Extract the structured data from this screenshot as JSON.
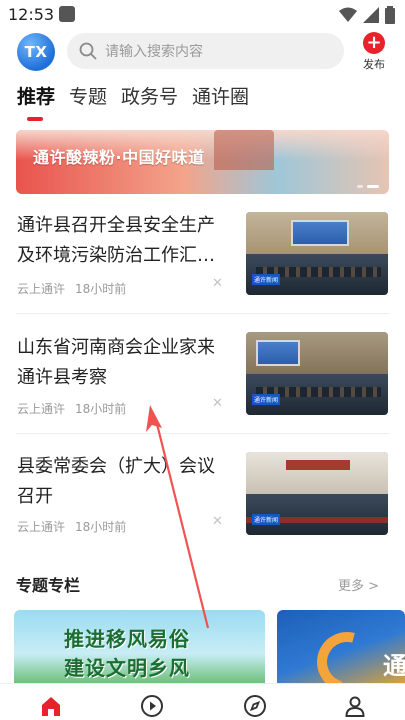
{
  "status_bar": {
    "time": "12:53"
  },
  "header": {
    "logo_text": "TX",
    "search_placeholder": "请输入搜索内容",
    "publish_label": "发布"
  },
  "tabs": [
    {
      "label": "推荐",
      "active": true
    },
    {
      "label": "专题",
      "active": false
    },
    {
      "label": "政务号",
      "active": false
    },
    {
      "label": "通许圈",
      "active": false
    }
  ],
  "banner": {
    "text": "通许酸辣粉·中国好味道"
  },
  "news": [
    {
      "title": "通许县召开全县安全生产及环境污染防治工作汇…",
      "source": "云上通许",
      "time": "18小时前",
      "thumb_label": "通许新闻"
    },
    {
      "title": "山东省河南商会企业家来通许县考察",
      "source": "云上通许",
      "time": "18小时前",
      "thumb_label": "通许新闻"
    },
    {
      "title": "县委常委会（扩大）会议召开",
      "source": "云上通许",
      "time": "18小时前",
      "thumb_label": "通许新闻"
    }
  ],
  "topics_section": {
    "title": "专题专栏",
    "more": "更多 >",
    "cards": [
      {
        "line1": "推进移风易俗",
        "line2": "建设文明乡风"
      },
      {
        "text": "通"
      }
    ]
  },
  "bottom_nav": [
    "home-icon",
    "video-play-icon",
    "compass-icon",
    "user-icon"
  ],
  "colors": {
    "accent": "#e8222a",
    "tab_active": "#111111",
    "meta_text": "#9a9a9a"
  }
}
